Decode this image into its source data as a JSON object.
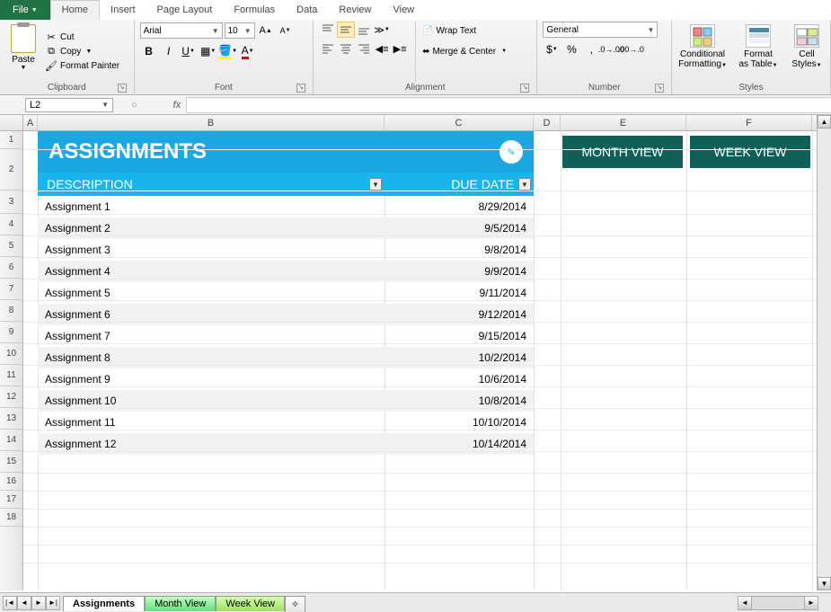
{
  "tabs": {
    "file": "File",
    "home": "Home",
    "insert": "Insert",
    "page_layout": "Page Layout",
    "formulas": "Formulas",
    "data": "Data",
    "review": "Review",
    "view": "View"
  },
  "clipboard": {
    "paste": "Paste",
    "cut": "Cut",
    "copy": "Copy",
    "format_painter": "Format Painter",
    "group": "Clipboard"
  },
  "font": {
    "name": "Arial",
    "size": "10",
    "group": "Font"
  },
  "alignment": {
    "wrap": "Wrap Text",
    "merge": "Merge & Center",
    "group": "Alignment"
  },
  "number": {
    "format": "General",
    "group": "Number"
  },
  "styles": {
    "cond": "Conditional Formatting",
    "fmt_table": "Format as Table",
    "cell": "Cell Styles",
    "group": "Styles"
  },
  "name_box": "L2",
  "fx": "fx",
  "cols": {
    "A": "A",
    "B": "B",
    "C": "C",
    "D": "D",
    "E": "E",
    "F": "F"
  },
  "banner": {
    "title": "ASSIGNMENTS"
  },
  "table_hdr": {
    "desc": "DESCRIPTION",
    "due": "DUE DATE"
  },
  "rows": [
    {
      "desc": "Assignment 1",
      "due": "8/29/2014"
    },
    {
      "desc": "Assignment 2",
      "due": "9/5/2014"
    },
    {
      "desc": "Assignment 3",
      "due": "9/8/2014"
    },
    {
      "desc": "Assignment 4",
      "due": "9/9/2014"
    },
    {
      "desc": "Assignment 5",
      "due": "9/11/2014"
    },
    {
      "desc": "Assignment 6",
      "due": "9/12/2014"
    },
    {
      "desc": "Assignment 7",
      "due": "9/15/2014"
    },
    {
      "desc": "Assignment 8",
      "due": "10/2/2014"
    },
    {
      "desc": "Assignment 9",
      "due": "10/6/2014"
    },
    {
      "desc": "Assignment 10",
      "due": "10/8/2014"
    },
    {
      "desc": "Assignment 11",
      "due": "10/10/2014"
    },
    {
      "desc": "Assignment 12",
      "due": "10/14/2014"
    }
  ],
  "buttons": {
    "month": "MONTH VIEW",
    "week": "WEEK VIEW"
  },
  "sheets": {
    "assignments": "Assignments",
    "month": "Month View",
    "week": "Week View"
  },
  "colors": {
    "banner": "#1ba8e0",
    "header": "#19b5ef",
    "btn": "#0f6158",
    "file": "#217346"
  }
}
